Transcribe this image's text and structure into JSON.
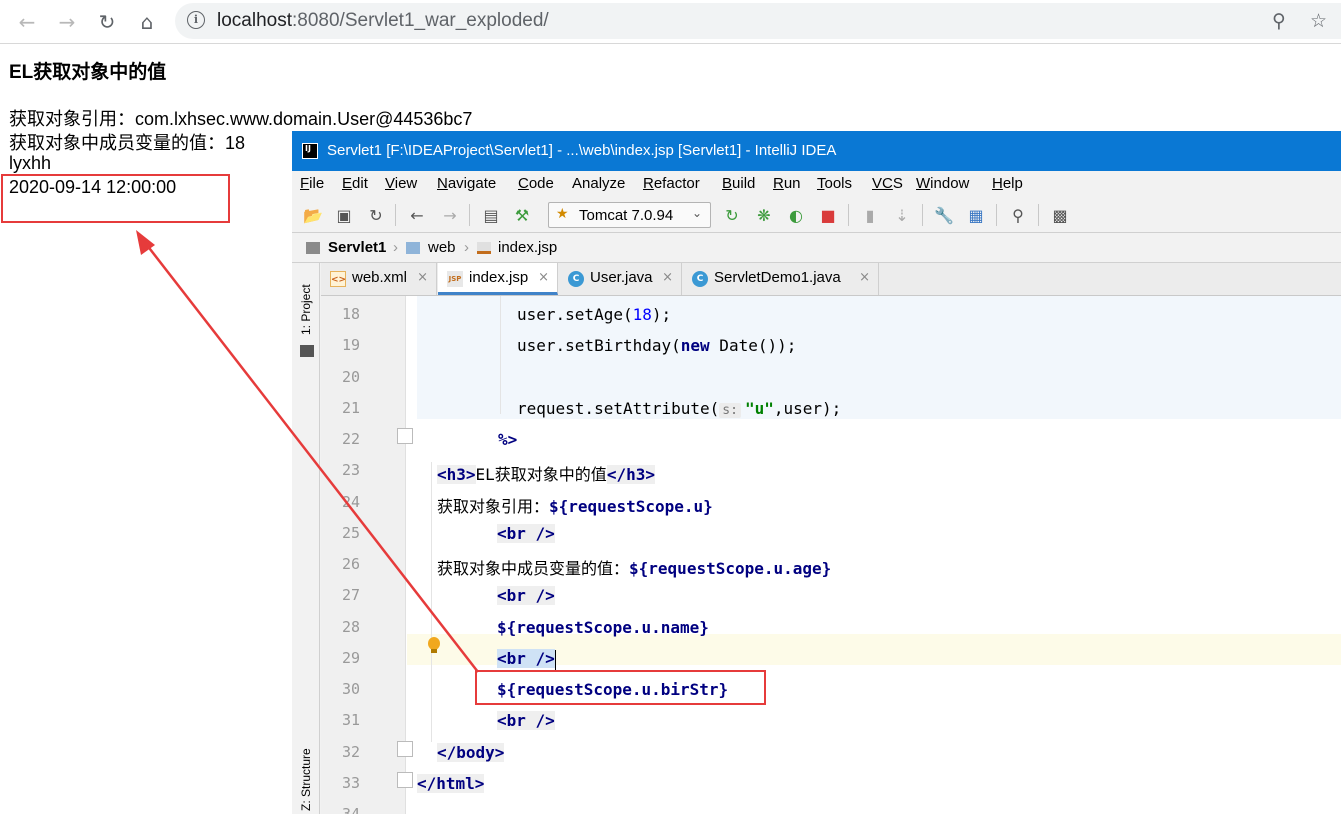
{
  "browser": {
    "back_icon": "arrow-left-icon",
    "forward_icon": "arrow-right-icon",
    "reload_icon": "reload-icon",
    "home_icon": "home-icon",
    "url_host": "localhost",
    "url_rest": ":8080/Servlet1_war_exploded/",
    "zoom_icon": "zoom-icon",
    "star_icon": "star-icon"
  },
  "page": {
    "heading": "EL获取对象中的值",
    "lines": [
      "获取对象引用：com.lxhsec.www.domain.User@44536bc7",
      "获取对象中成员变量的值：18",
      "lyxhh",
      "2020-09-14 12:00:00"
    ]
  },
  "ide": {
    "window_title": "Servlet1 [F:\\IDEAProject\\Servlet1] - ...\\web\\index.jsp [Servlet1] - IntelliJ IDEA",
    "menu": [
      {
        "u": "F",
        "rest": "ile"
      },
      {
        "u": "E",
        "rest": "dit"
      },
      {
        "u": "V",
        "rest": "iew"
      },
      {
        "u": "N",
        "rest": "avigate"
      },
      {
        "u": "C",
        "rest": "ode"
      },
      {
        "u": "",
        "rest": "Analyze"
      },
      {
        "u": "R",
        "rest": "efactor"
      },
      {
        "u": "B",
        "rest": "uild"
      },
      {
        "u": "R",
        "rest": "un"
      },
      {
        "u": "T",
        "rest": "ools"
      },
      {
        "u": "VC",
        "rest": "S"
      },
      {
        "u": "W",
        "rest": "indow"
      },
      {
        "u": "H",
        "rest": "elp"
      }
    ],
    "run_config": "Tomcat 7.0.94",
    "breadcrumb": [
      "Servlet1",
      "web",
      "index.jsp"
    ],
    "side_project": "1: Project",
    "side_structure": "Z: Structure",
    "tabs": [
      {
        "label": "web.xml",
        "type": "xml",
        "active": false
      },
      {
        "label": "index.jsp",
        "type": "jsp",
        "active": true
      },
      {
        "label": "User.java",
        "type": "java",
        "active": false
      },
      {
        "label": "ServletDemo1.java",
        "type": "java",
        "active": false
      }
    ],
    "line_numbers": [
      "18",
      "19",
      "20",
      "21",
      "22",
      "23",
      "24",
      "25",
      "26",
      "27",
      "28",
      "29",
      "30",
      "31",
      "32",
      "33",
      "34"
    ],
    "code": {
      "l18a": "user.setAge(",
      "l18n": "18",
      "l18b": ");",
      "l19a": "user.setBirthday(",
      "l19k": "new",
      "l19b": " Date());",
      "l21a": "request.setAttribute(",
      "l21hint": "s:",
      "l21s": "\"u\"",
      "l21b": ",user);",
      "l22": "%>",
      "l23t1": "<h3>",
      "l23txt": "EL获取对象中的值",
      "l23t2": "</h3>",
      "l24txt": "获取对象引用：",
      "l24el": "${requestScope.u}",
      "br": "<br />",
      "l26txt": "获取对象中成员变量的值：",
      "l26el": "${requestScope.u.age}",
      "l28el": "${requestScope.u.name}",
      "l30el": "${requestScope.u.birStr}",
      "l32": "</body>",
      "l33": "</html>"
    }
  },
  "annotation_color": "#e63b3b"
}
